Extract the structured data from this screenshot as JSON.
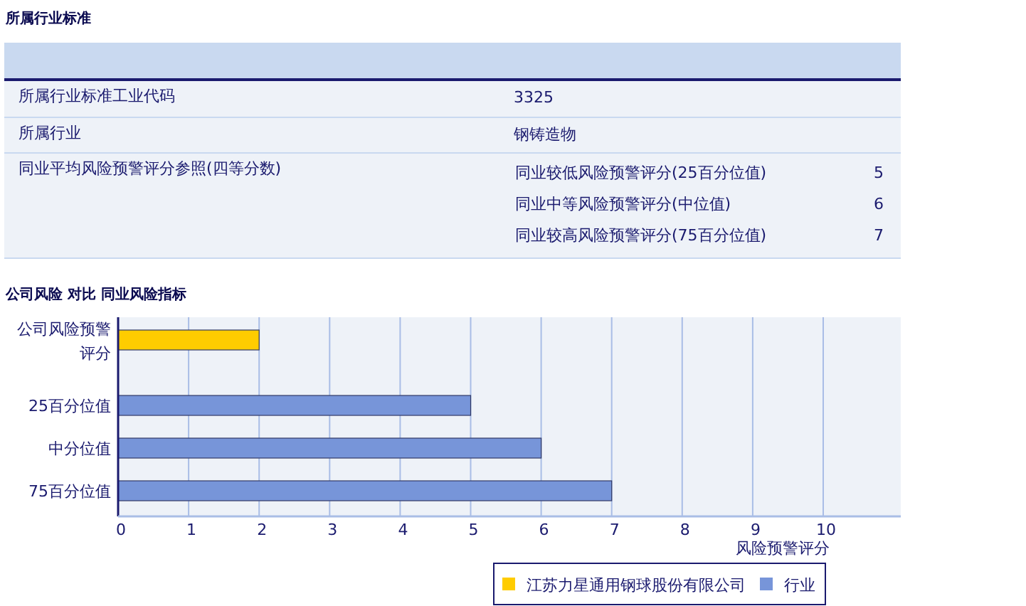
{
  "section_title": "所属行业标准",
  "table": {
    "rows": [
      {
        "label": "所属行业标准工业代码",
        "value": "3325"
      },
      {
        "label": "所属行业",
        "value": "钢铸造物"
      },
      {
        "label": "同业平均风险预警评分参照(四等分数)",
        "sub_rows": [
          {
            "label": "同业较低风险预警评分(25百分位值)",
            "value": "5"
          },
          {
            "label": "同业中等风险预警评分(中位值)",
            "value": "6"
          },
          {
            "label": "同业较高风险预警评分(75百分位值)",
            "value": "7"
          }
        ]
      }
    ]
  },
  "chart_title": "公司风险 对比 同业风险指标",
  "chart_data": {
    "type": "bar",
    "orientation": "horizontal",
    "grid": true,
    "legend": true,
    "xlabel": "风险预警评分",
    "categories": [
      "公司风险预警评分",
      "25百分位值",
      "中分位值",
      "75百分位值"
    ],
    "series": [
      {
        "name": "江苏力星通用钢球股份有限公司",
        "color": "#ffcc00",
        "values": [
          2,
          null,
          null,
          null
        ]
      },
      {
        "name": "行业",
        "color": "#7795d9",
        "values": [
          null,
          5,
          6,
          7
        ]
      }
    ],
    "xlim": [
      0,
      11.1
    ],
    "xticks": [
      0,
      1,
      2,
      3,
      4,
      5,
      6,
      7,
      8,
      9,
      10
    ]
  }
}
